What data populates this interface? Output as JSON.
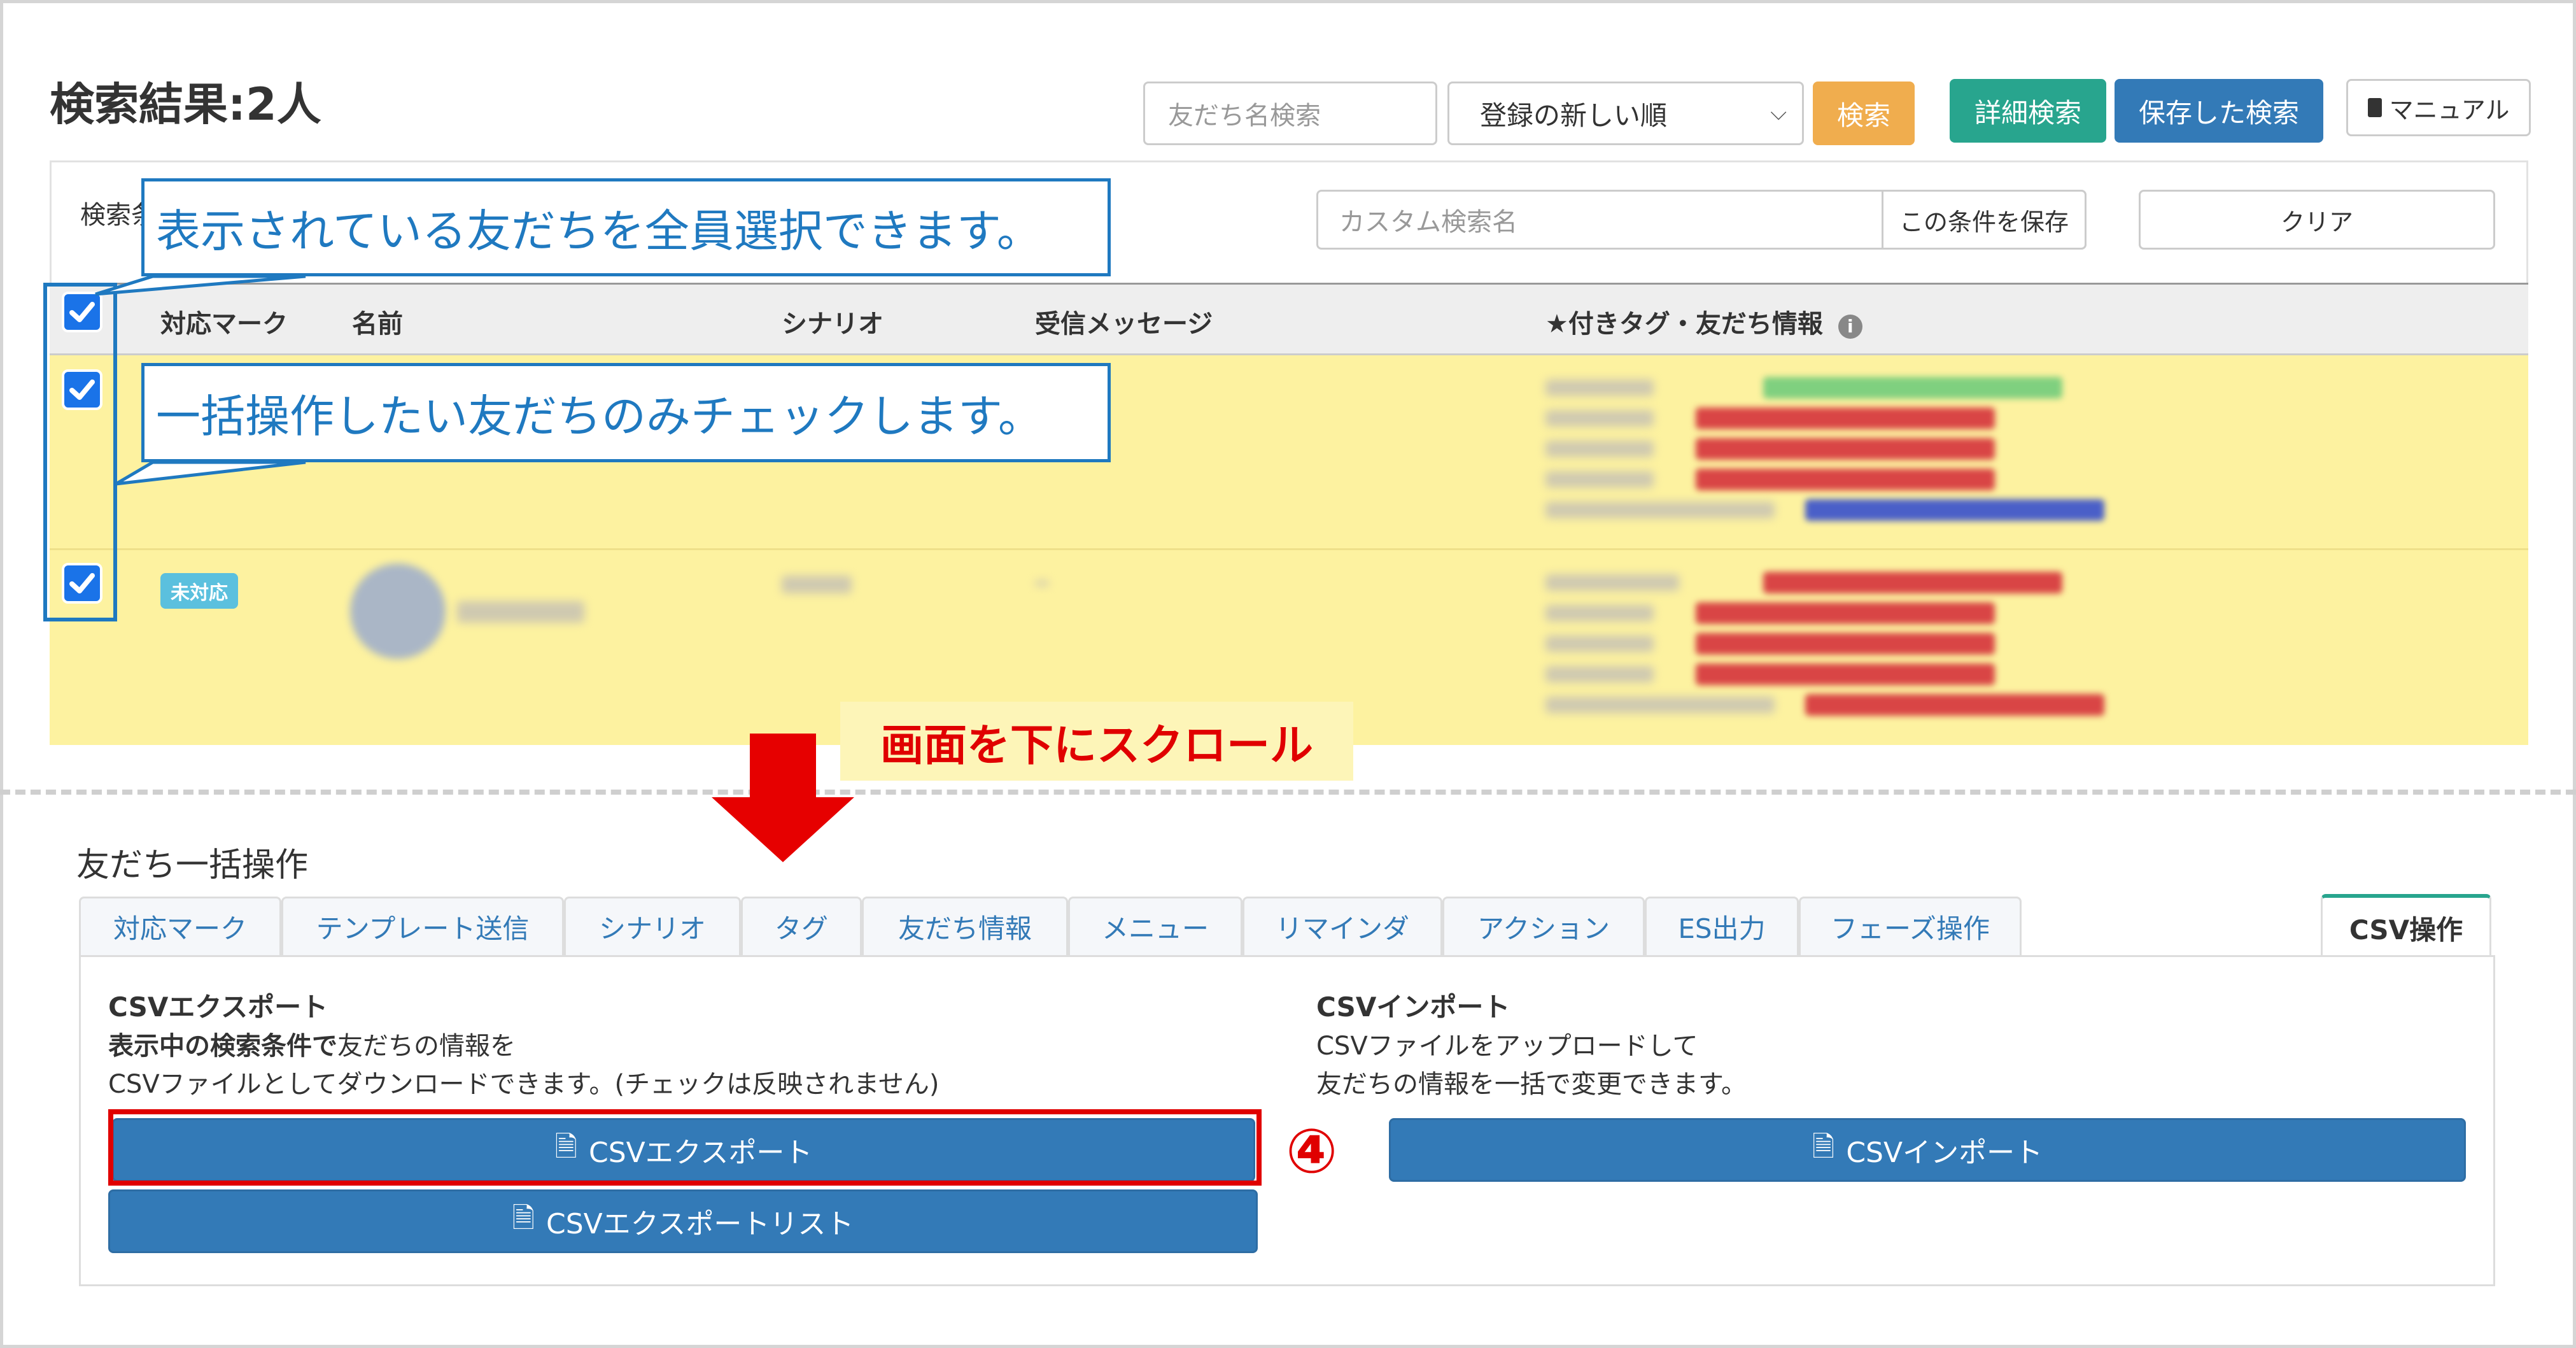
{
  "header": {
    "title": "検索結果:2人",
    "search_placeholder": "友だち名検索",
    "sort_selected": "登録の新しい順",
    "search_button": "検索",
    "advanced_search_button": "詳細検索",
    "saved_search_button": "保存した検索",
    "manual_button": "マニュアル"
  },
  "filter": {
    "label": "検索条",
    "custom_name_placeholder": "カスタム検索名",
    "save_condition_button": "この条件を保存",
    "clear_button": "クリア"
  },
  "table": {
    "columns": [
      "対応マーク",
      "名前",
      "シナリオ",
      "受信メッセージ",
      "★付きタグ・友だち情報"
    ],
    "rows": [
      {
        "checked": true,
        "mark": "",
        "status": ""
      },
      {
        "checked": true,
        "mark": "未対応",
        "status": ""
      }
    ]
  },
  "annotations": {
    "select_all": "表示されている友だちを全員選択できます。",
    "check_some": "一括操作したい友だちのみチェックします。",
    "scroll": "画面を下にスクロール",
    "step": "④"
  },
  "bulk": {
    "title": "友だち一括操作",
    "tabs": [
      "対応マーク",
      "テンプレート送信",
      "シナリオ",
      "タグ",
      "友だち情報",
      "メニュー",
      "リマインダ",
      "アクション",
      "ES出力",
      "フェーズ操作",
      "CSV操作"
    ],
    "active_tab": "CSV操作",
    "export": {
      "title": "CSVエクスポート",
      "desc_bold": "表示中の検索条件で",
      "desc_rest": "友だちの情報を",
      "desc_line2": "CSVファイルとしてダウンロードできます。(チェックは反映されません)",
      "button": "CSVエクスポート",
      "list_button": "CSVエクスポートリスト"
    },
    "import": {
      "title": "CSVインポート",
      "desc_line1": "CSVファイルをアップロードして",
      "desc_line2": "友だちの情報を一括で変更できます。",
      "button": "CSVインポート"
    }
  },
  "colors": {
    "primary": "#337ab7",
    "success": "#28a58e",
    "warning": "#f0ad4e",
    "callout": "#1f79c0",
    "highlight": "#e00000",
    "row": "#fdf2a0"
  }
}
